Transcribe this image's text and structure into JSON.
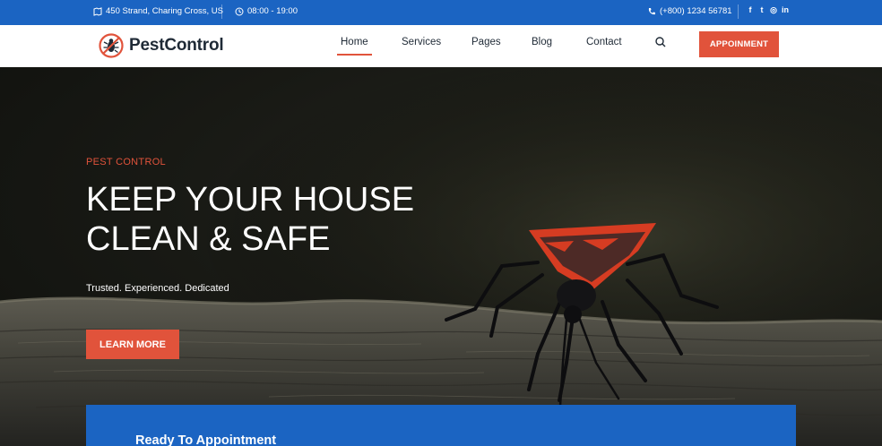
{
  "topbar": {
    "address": "450 Strand, Charing Cross, US",
    "hours": "08:00 - 19:00",
    "phone": "(+800) 1234 56781",
    "social_icons": [
      "facebook-icon",
      "twitter-icon",
      "instagram-icon",
      "linkedin-icon"
    ],
    "social_glyphs": [
      "f",
      "t",
      "◎",
      "in"
    ]
  },
  "header": {
    "logo_text": "PestControl",
    "nav": [
      "Home",
      "Services",
      "Pages",
      "Blog",
      "Contact"
    ],
    "active_nav": "Home",
    "cta_label": "APPOINMENT"
  },
  "hero": {
    "eyebrow": "PEST CONTROL",
    "headline_line1": "KEEP YOUR HOUSE",
    "headline_line2": "CLEAN & SAFE",
    "tagline": "Trusted. Experienced. Dedicated",
    "button_label": "LEARN MORE"
  },
  "ready": {
    "title": "Ready To Appointment"
  },
  "colors": {
    "primary_blue": "#1b64c2",
    "accent_orange": "#e1533b",
    "text_dark": "#1f2a36"
  }
}
